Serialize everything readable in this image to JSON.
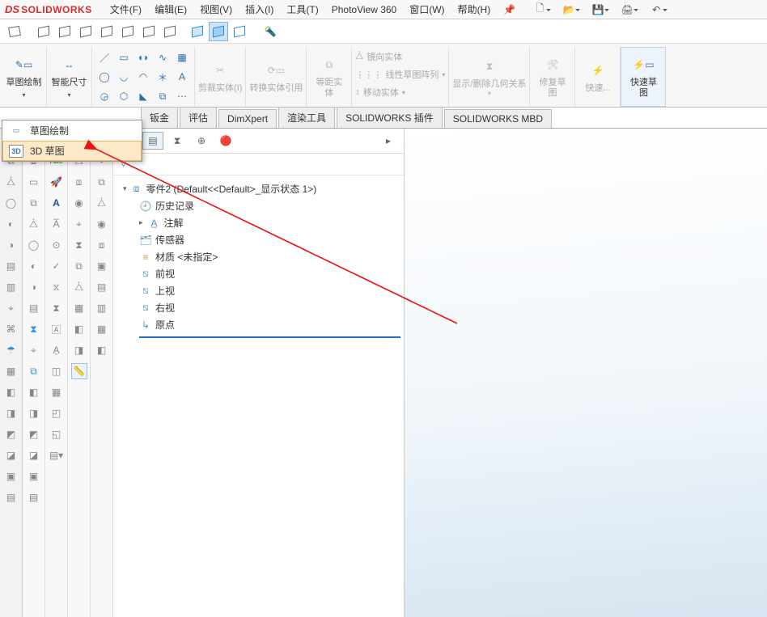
{
  "app": {
    "name": "SOLIDWORKS"
  },
  "menu": {
    "file": "文件(F)",
    "edit": "编辑(E)",
    "view": "视图(V)",
    "insert": "插入(I)",
    "tools": "工具(T)",
    "pv360": "PhotoView 360",
    "window": "窗口(W)",
    "help": "帮助(H)"
  },
  "ribbon": {
    "sketch": "草图绘制",
    "smartdim": "智能尺寸",
    "trim": "剪裁实体(I)",
    "convert": "转换实体引用",
    "equidist": {
      "top": "等距实",
      "bot": "体"
    },
    "mirror": "镜向实体",
    "lpattern": "线性草图阵列",
    "move": "移动实体",
    "showdel": "显示/删除几何关系",
    "repair": {
      "top": "修复草",
      "bot": "图"
    },
    "quick": "快速...",
    "quicksk": {
      "top": "快速草",
      "bot": "图"
    }
  },
  "tabs": {
    "sheetmetal": "钣金",
    "evaluate": "评估",
    "dimxpert": "DimXpert",
    "rendertools": "渲染工具",
    "swaddins": "SOLIDWORKS 插件",
    "swmbd": "SOLIDWORKS MBD"
  },
  "dropdown": {
    "sketch": "草图绘制",
    "sketch3d": "3D 草图",
    "sketch3d_prefix": "3D"
  },
  "tree": {
    "root": "零件2  (Default<<Default>_显示状态 1>)",
    "history": "历史记录",
    "annotations": "注解",
    "sensors": "传感器",
    "material": "材质 <未指定>",
    "front": "前视",
    "top": "上视",
    "right": "右视",
    "origin": "原点"
  }
}
